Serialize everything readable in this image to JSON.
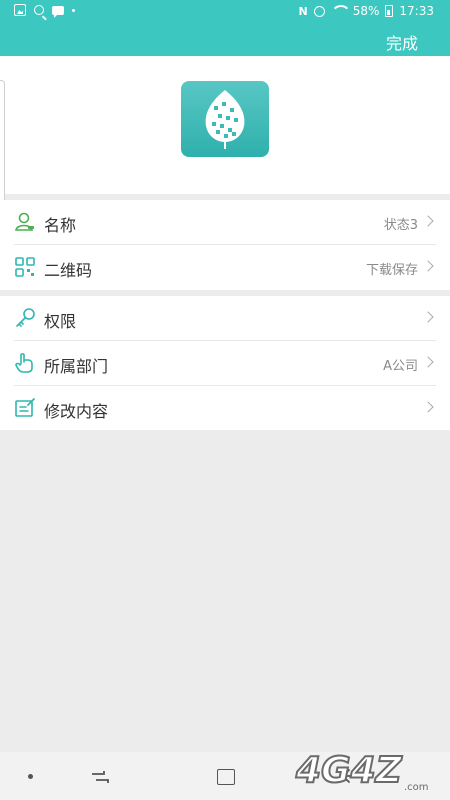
{
  "status_bar": {
    "battery": "58%",
    "time": "17:33",
    "left_icons": [
      "gallery-icon",
      "search-icon",
      "message-icon",
      "dot-icon"
    ],
    "right_icons": [
      "nfc-icon",
      "alarm-icon",
      "wifi-icon",
      "battery-charging-icon"
    ]
  },
  "header": {
    "done_label": "完成",
    "background": "#3cc8c0"
  },
  "groups": [
    {
      "rows": [
        {
          "label": "名称",
          "value": "状态3",
          "icon": "person-icon"
        },
        {
          "label": "二维码",
          "value": "下载保存",
          "icon": "qr-code-icon"
        }
      ]
    },
    {
      "rows": [
        {
          "label": "权限",
          "value": "",
          "icon": "key-icon"
        },
        {
          "label": "所属部门",
          "value": "A公司",
          "icon": "hand-icon"
        },
        {
          "label": "修改内容",
          "value": "",
          "icon": "edit-icon"
        }
      ]
    }
  ],
  "logo": {
    "icon": "leaf-qr-logo"
  },
  "nav_bar": {
    "buttons": [
      "dot-button",
      "recent-apps-button",
      "home-button",
      "back-button"
    ]
  },
  "watermark": {
    "text": "4G4Z.com"
  },
  "colors": {
    "accent": "#3cc8c0",
    "row_icon_teal": "#2fb7b0",
    "row_icon_green": "#4caf50",
    "value_gray": "#8a8a8a",
    "background": "#ececec"
  }
}
